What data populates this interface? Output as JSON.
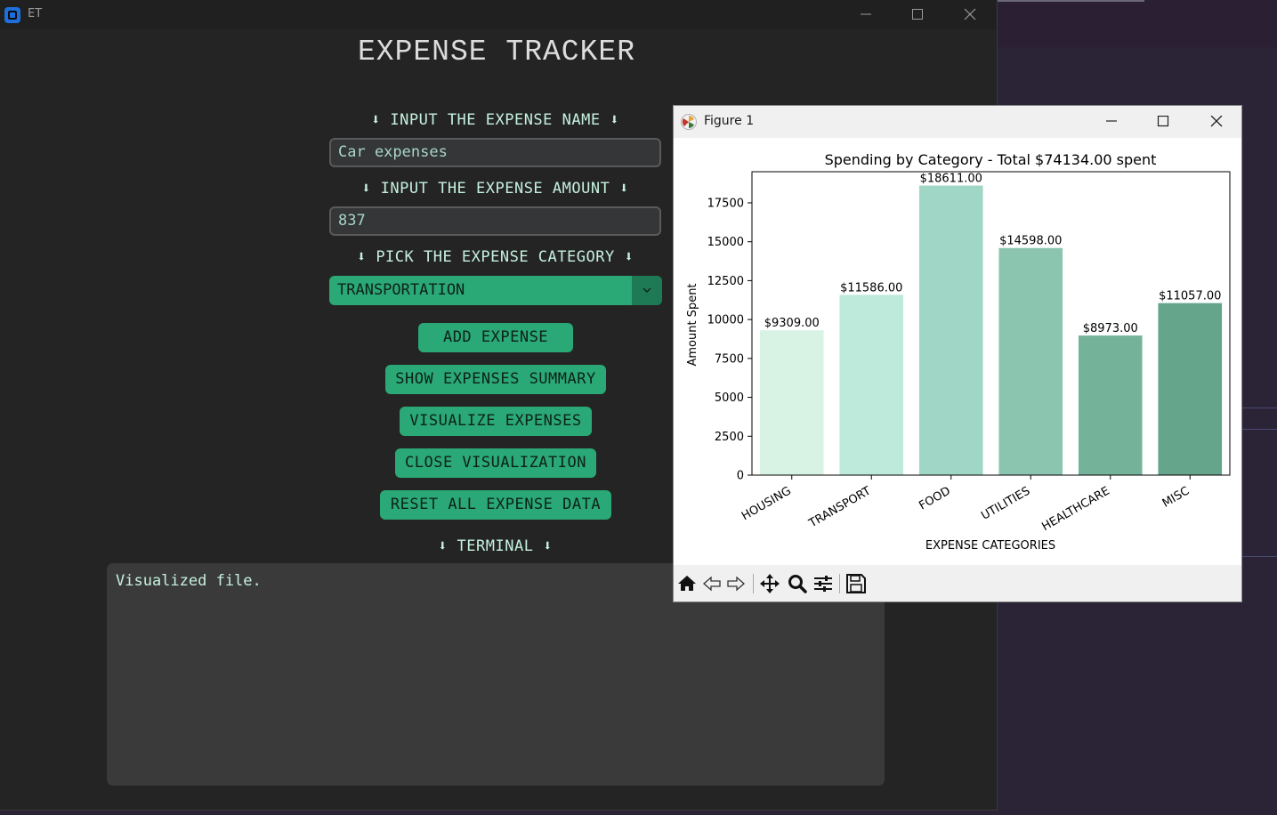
{
  "app": {
    "title": "ET",
    "heading": "EXPENSE TRACKER",
    "name_label": "⬇ INPUT THE EXPENSE NAME ⬇",
    "name_value": "Car expenses",
    "amount_label": "⬇ INPUT THE EXPENSE AMOUNT ⬇",
    "amount_value": "837",
    "category_label": "⬇ PICK THE EXPENSE CATEGORY ⬇",
    "category_value": "TRANSPORTATION",
    "buttons": {
      "add": "ADD EXPENSE",
      "summary": "SHOW EXPENSES SUMMARY",
      "visualize": "VISUALIZE EXPENSES",
      "close": "CLOSE VISUALIZATION",
      "reset": "RESET ALL EXPENSE DATA"
    },
    "terminal_label": "⬇ TERMINAL ⬇",
    "terminal_text": "Visualized file."
  },
  "figure": {
    "title": "Figure 1",
    "toolbar_icons": [
      "home-icon",
      "back-icon",
      "forward-icon",
      "pan-icon",
      "zoom-icon",
      "configure-icon",
      "save-icon"
    ]
  },
  "chart_data": {
    "type": "bar",
    "title": "Spending by Category - Total $74134.00 spent",
    "xlabel": "EXPENSE CATEGORIES",
    "ylabel": "Amount Spent",
    "categories": [
      "HOUSING",
      "TRANSPORT",
      "FOOD",
      "UTILITIES",
      "HEALTHCARE",
      "MISC"
    ],
    "values": [
      9309,
      11586,
      18611,
      14598,
      8973,
      11057
    ],
    "value_labels": [
      "$9309.00",
      "$11586.00",
      "$18611.00",
      "$14598.00",
      "$8973.00",
      "$11057.00"
    ],
    "colors": [
      "#d8f3e3",
      "#bdeadb",
      "#9fd6c5",
      "#8cc5af",
      "#74b39a",
      "#65a58c"
    ],
    "yticks": [
      0,
      2500,
      5000,
      7500,
      10000,
      12500,
      15000,
      17500
    ],
    "ylim": [
      0,
      19500
    ],
    "grid": false
  }
}
